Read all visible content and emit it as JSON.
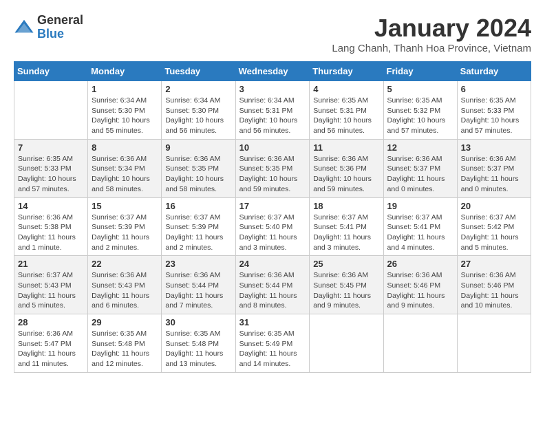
{
  "logo": {
    "general": "General",
    "blue": "Blue"
  },
  "title": "January 2024",
  "subtitle": "Lang Chanh, Thanh Hoa Province, Vietnam",
  "headers": [
    "Sunday",
    "Monday",
    "Tuesday",
    "Wednesday",
    "Thursday",
    "Friday",
    "Saturday"
  ],
  "weeks": [
    [
      {
        "day": "",
        "info": ""
      },
      {
        "day": "1",
        "info": "Sunrise: 6:34 AM\nSunset: 5:30 PM\nDaylight: 10 hours\nand 55 minutes."
      },
      {
        "day": "2",
        "info": "Sunrise: 6:34 AM\nSunset: 5:30 PM\nDaylight: 10 hours\nand 56 minutes."
      },
      {
        "day": "3",
        "info": "Sunrise: 6:34 AM\nSunset: 5:31 PM\nDaylight: 10 hours\nand 56 minutes."
      },
      {
        "day": "4",
        "info": "Sunrise: 6:35 AM\nSunset: 5:31 PM\nDaylight: 10 hours\nand 56 minutes."
      },
      {
        "day": "5",
        "info": "Sunrise: 6:35 AM\nSunset: 5:32 PM\nDaylight: 10 hours\nand 57 minutes."
      },
      {
        "day": "6",
        "info": "Sunrise: 6:35 AM\nSunset: 5:33 PM\nDaylight: 10 hours\nand 57 minutes."
      }
    ],
    [
      {
        "day": "7",
        "info": "Sunrise: 6:35 AM\nSunset: 5:33 PM\nDaylight: 10 hours\nand 57 minutes."
      },
      {
        "day": "8",
        "info": "Sunrise: 6:36 AM\nSunset: 5:34 PM\nDaylight: 10 hours\nand 58 minutes."
      },
      {
        "day": "9",
        "info": "Sunrise: 6:36 AM\nSunset: 5:35 PM\nDaylight: 10 hours\nand 58 minutes."
      },
      {
        "day": "10",
        "info": "Sunrise: 6:36 AM\nSunset: 5:35 PM\nDaylight: 10 hours\nand 59 minutes."
      },
      {
        "day": "11",
        "info": "Sunrise: 6:36 AM\nSunset: 5:36 PM\nDaylight: 10 hours\nand 59 minutes."
      },
      {
        "day": "12",
        "info": "Sunrise: 6:36 AM\nSunset: 5:37 PM\nDaylight: 11 hours\nand 0 minutes."
      },
      {
        "day": "13",
        "info": "Sunrise: 6:36 AM\nSunset: 5:37 PM\nDaylight: 11 hours\nand 0 minutes."
      }
    ],
    [
      {
        "day": "14",
        "info": "Sunrise: 6:36 AM\nSunset: 5:38 PM\nDaylight: 11 hours\nand 1 minute."
      },
      {
        "day": "15",
        "info": "Sunrise: 6:37 AM\nSunset: 5:39 PM\nDaylight: 11 hours\nand 2 minutes."
      },
      {
        "day": "16",
        "info": "Sunrise: 6:37 AM\nSunset: 5:39 PM\nDaylight: 11 hours\nand 2 minutes."
      },
      {
        "day": "17",
        "info": "Sunrise: 6:37 AM\nSunset: 5:40 PM\nDaylight: 11 hours\nand 3 minutes."
      },
      {
        "day": "18",
        "info": "Sunrise: 6:37 AM\nSunset: 5:41 PM\nDaylight: 11 hours\nand 3 minutes."
      },
      {
        "day": "19",
        "info": "Sunrise: 6:37 AM\nSunset: 5:41 PM\nDaylight: 11 hours\nand 4 minutes."
      },
      {
        "day": "20",
        "info": "Sunrise: 6:37 AM\nSunset: 5:42 PM\nDaylight: 11 hours\nand 5 minutes."
      }
    ],
    [
      {
        "day": "21",
        "info": "Sunrise: 6:37 AM\nSunset: 5:43 PM\nDaylight: 11 hours\nand 5 minutes."
      },
      {
        "day": "22",
        "info": "Sunrise: 6:36 AM\nSunset: 5:43 PM\nDaylight: 11 hours\nand 6 minutes."
      },
      {
        "day": "23",
        "info": "Sunrise: 6:36 AM\nSunset: 5:44 PM\nDaylight: 11 hours\nand 7 minutes."
      },
      {
        "day": "24",
        "info": "Sunrise: 6:36 AM\nSunset: 5:44 PM\nDaylight: 11 hours\nand 8 minutes."
      },
      {
        "day": "25",
        "info": "Sunrise: 6:36 AM\nSunset: 5:45 PM\nDaylight: 11 hours\nand 9 minutes."
      },
      {
        "day": "26",
        "info": "Sunrise: 6:36 AM\nSunset: 5:46 PM\nDaylight: 11 hours\nand 9 minutes."
      },
      {
        "day": "27",
        "info": "Sunrise: 6:36 AM\nSunset: 5:46 PM\nDaylight: 11 hours\nand 10 minutes."
      }
    ],
    [
      {
        "day": "28",
        "info": "Sunrise: 6:36 AM\nSunset: 5:47 PM\nDaylight: 11 hours\nand 11 minutes."
      },
      {
        "day": "29",
        "info": "Sunrise: 6:35 AM\nSunset: 5:48 PM\nDaylight: 11 hours\nand 12 minutes."
      },
      {
        "day": "30",
        "info": "Sunrise: 6:35 AM\nSunset: 5:48 PM\nDaylight: 11 hours\nand 13 minutes."
      },
      {
        "day": "31",
        "info": "Sunrise: 6:35 AM\nSunset: 5:49 PM\nDaylight: 11 hours\nand 14 minutes."
      },
      {
        "day": "",
        "info": ""
      },
      {
        "day": "",
        "info": ""
      },
      {
        "day": "",
        "info": ""
      }
    ]
  ]
}
